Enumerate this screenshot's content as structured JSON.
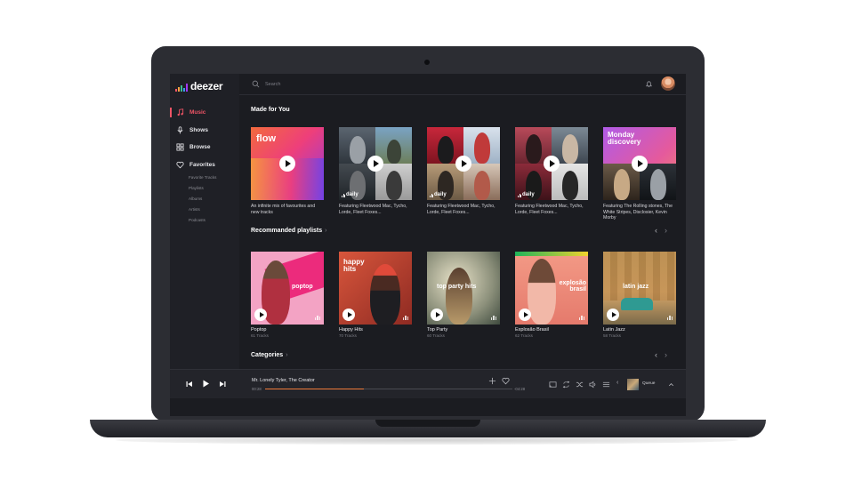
{
  "brand": {
    "name": "deezer",
    "bar_colors": [
      "#ef5466",
      "#f8a543",
      "#3ebd8f",
      "#3d99f0",
      "#a238ff"
    ]
  },
  "sidebar": {
    "items": [
      {
        "label": "Music",
        "icon": "music-note-icon",
        "active": true
      },
      {
        "label": "Shows",
        "icon": "microphone-icon",
        "active": false
      },
      {
        "label": "Browse",
        "icon": "grid-icon",
        "active": false
      },
      {
        "label": "Favorites",
        "icon": "heart-icon",
        "active": false
      }
    ],
    "sub_items": [
      "Favorite Tracks",
      "Playlists",
      "Albums",
      "Artists",
      "Podcasts"
    ]
  },
  "topbar": {
    "search_placeholder": "Search",
    "bell_icon": "bell-icon"
  },
  "sections": {
    "made_for_you": {
      "title": "Made for You",
      "cards": [
        {
          "art_title": "flow",
          "desc": "An infinite mix of favourites and new tracks"
        },
        {
          "art_title": "daily",
          "desc": "Featuring Fleetwood Mac, Tycho, Lorde, Fleet Foxes..."
        },
        {
          "art_title": "daily",
          "desc": "Featuring Fleetwood Mac, Tycho, Lorde, Fleet Foxes..."
        },
        {
          "art_title": "daily",
          "desc": "Featuring Fleetwood Mac, Tycho, Lorde, Fleet Foxes..."
        },
        {
          "art_title": "Monday discovery",
          "desc": "Featuring The Rolling stones, The White Stripes, Disclosier, Kevin Morby"
        }
      ]
    },
    "recommended": {
      "title": "Recommanded playlists",
      "cards": [
        {
          "art_title": "poptop",
          "name": "Poptop",
          "tracks": "61 Tracks"
        },
        {
          "art_title": "happy hits",
          "name": "Happy Hits",
          "tracks": "70 Tracks"
        },
        {
          "art_title": "top party hits",
          "name": "Top Party",
          "tracks": "60 Tracks"
        },
        {
          "art_title": "explosão brasil",
          "name": "Explosão Brasil",
          "tracks": "62 Tracks"
        },
        {
          "art_title": "latin jazz",
          "name": "Latin Jazz",
          "tracks": "58 Tracks"
        }
      ]
    },
    "categories": {
      "title": "Categories"
    }
  },
  "player": {
    "track": "Mr. Lonely Tyler, The Creator",
    "elapsed": "00:28",
    "remaining": "-04:28",
    "progress": 0.4,
    "queue_label": "Queue",
    "accent": "#ef7a3a"
  }
}
